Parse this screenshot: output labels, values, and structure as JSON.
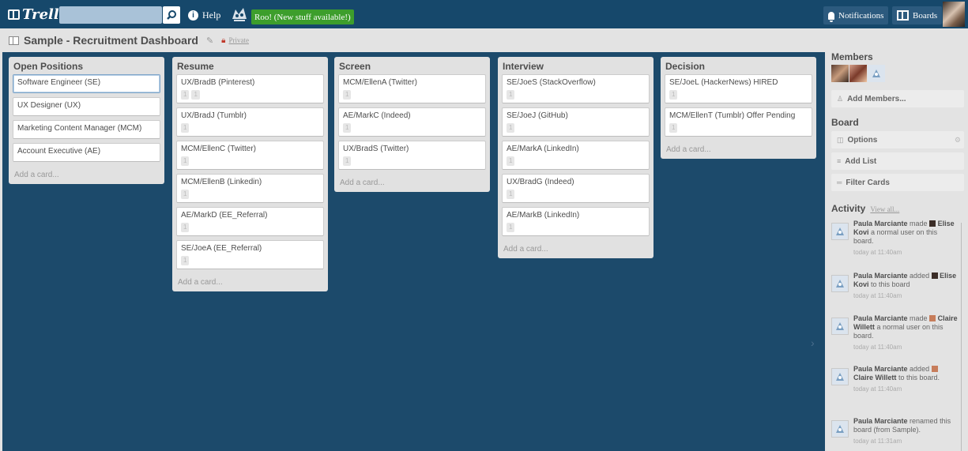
{
  "header": {
    "search_value": "",
    "help_label": "Help",
    "announcement": "Roo! (New stuff available!)",
    "notifications_label": "Notifications",
    "boards_label": "Boards"
  },
  "board": {
    "title": "Sample - Recruitment Dashboard",
    "visibility": "Private"
  },
  "lists": [
    {
      "title": "Open Positions",
      "cards": [
        {
          "title": "Software Engineer (SE)",
          "badges": [],
          "selected": true
        },
        {
          "title": "UX Designer (UX)",
          "badges": []
        },
        {
          "title": "Marketing Content Manager (MCM)",
          "badges": []
        },
        {
          "title": "Account Executive (AE)",
          "badges": []
        }
      ],
      "add_label": "Add a card..."
    },
    {
      "title": "Resume",
      "cards": [
        {
          "title": "UX/BradB (Pinterest)",
          "badges": [
            "1",
            "1"
          ]
        },
        {
          "title": "UX/BradJ (Tumblr)",
          "badges": [
            "1"
          ]
        },
        {
          "title": "MCM/EllenC (Twitter)",
          "badges": [
            "1"
          ]
        },
        {
          "title": "MCM/EllenB (Linkedin)",
          "badges": [
            "1"
          ]
        },
        {
          "title": "AE/MarkD (EE_Referral)",
          "badges": [
            "1"
          ]
        },
        {
          "title": "SE/JoeA (EE_Referral)",
          "badges": [
            "1"
          ]
        }
      ],
      "add_label": "Add a card..."
    },
    {
      "title": "Screen",
      "cards": [
        {
          "title": "MCM/EllenA (Twitter)",
          "badges": [
            "1"
          ]
        },
        {
          "title": "AE/MarkC (Indeed)",
          "badges": [
            "1"
          ]
        },
        {
          "title": "UX/BradS (Twitter)",
          "badges": [
            "1"
          ]
        }
      ],
      "add_label": "Add a card..."
    },
    {
      "title": "Interview",
      "cards": [
        {
          "title": "SE/JoeS (StackOverflow)",
          "badges": [
            "1"
          ]
        },
        {
          "title": "SE/JoeJ (GitHub)",
          "badges": [
            "1"
          ]
        },
        {
          "title": "AE/MarkA (LinkedIn)",
          "badges": [
            "1"
          ]
        },
        {
          "title": "UX/BradG (Indeed)",
          "badges": [
            "1"
          ]
        },
        {
          "title": "AE/MarkB (LinkedIn)",
          "badges": [
            "1"
          ]
        }
      ],
      "add_label": "Add a card..."
    },
    {
      "title": "Decision",
      "cards": [
        {
          "title": "SE/JoeL (HackerNews) HIRED",
          "badges": [
            "1"
          ]
        },
        {
          "title": "MCM/EllenT (Tumblr) Offer Pending",
          "badges": [
            "1"
          ]
        }
      ],
      "add_label": "Add a card..."
    }
  ],
  "sidebar": {
    "members_heading": "Members",
    "add_members": "Add Members...",
    "board_heading": "Board",
    "options": "Options",
    "add_list": "Add List",
    "filter_cards": "Filter Cards",
    "activity_heading": "Activity",
    "view_all": "View all...",
    "activity": [
      {
        "actor": "Paula Marciante",
        "verb": "made",
        "target": "Elise Kovi",
        "rest": "a normal user on this board.",
        "time": "today at 11:40am"
      },
      {
        "actor": "Paula Marciante",
        "verb": "added",
        "target": "Elise Kovi",
        "rest": "to this board",
        "time": "today at 11:40am"
      },
      {
        "actor": "Paula Marciante",
        "verb": "made",
        "target": "Claire Willett",
        "rest": "a normal user on this board.",
        "time": "today at 11:40am"
      },
      {
        "actor": "Paula Marciante",
        "verb": "added",
        "target": "Claire Willett",
        "rest": "to this board.",
        "time": "today at 11:40am"
      },
      {
        "actor": "Paula Marciante",
        "verb": "renamed",
        "target": "",
        "rest": "this board (from Sample).",
        "time": "today at 11:31am"
      }
    ]
  }
}
